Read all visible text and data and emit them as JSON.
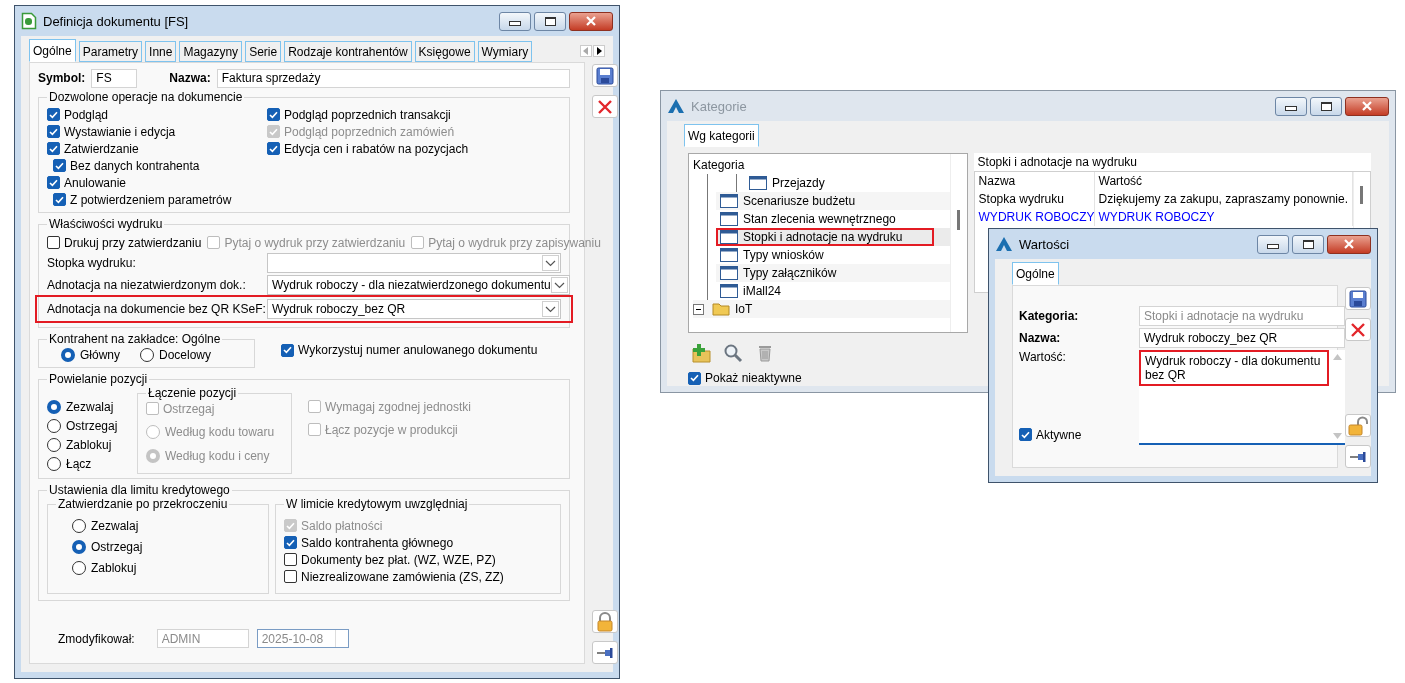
{
  "document_window": {
    "title": "Definicja dokumentu [FS]",
    "focused": true,
    "tabs": [
      {
        "label": "Ogólne",
        "selected": true
      },
      {
        "label": "Parametry",
        "selected": false
      },
      {
        "label": "Inne",
        "selected": false
      },
      {
        "label": "Magazyny",
        "selected": false
      },
      {
        "label": "Serie",
        "selected": false
      },
      {
        "label": "Rodzaje kontrahentów",
        "selected": false
      },
      {
        "label": "Księgowe",
        "selected": false
      },
      {
        "label": "Wymiary",
        "selected": false
      }
    ],
    "symbol": {
      "label": "Symbol:",
      "value": "FS"
    },
    "name": {
      "label": "Nazwa:",
      "value": "Faktura sprzedaży"
    },
    "operations": {
      "title": "Dozwolone operacje na dokumencie",
      "left": [
        {
          "label": "Podgląd",
          "checked": true,
          "disabled": false
        },
        {
          "label": "Wystawianie i edycja",
          "checked": true,
          "disabled": false
        },
        {
          "label": "Zatwierdzanie",
          "checked": true,
          "disabled": false,
          "children": [
            {
              "label": "Bez danych kontrahenta",
              "checked": true,
              "disabled": false
            }
          ]
        },
        {
          "label": "Anulowanie",
          "checked": true,
          "disabled": false,
          "children": [
            {
              "label": "Z potwierdzeniem parametrów",
              "checked": true,
              "disabled": false
            }
          ]
        }
      ],
      "right": [
        {
          "label": "Podgląd poprzednich transakcji",
          "checked": true,
          "disabled": false
        },
        {
          "label": "Podgląd poprzednich zamówień",
          "checked": true,
          "disabled": true
        },
        {
          "label": "Edycja cen i rabatów na pozycjach",
          "checked": true,
          "disabled": false
        }
      ]
    },
    "print": {
      "title": "Właściwości wydruku",
      "options": [
        {
          "label": "Drukuj przy zatwierdzaniu",
          "checked": false,
          "disabled": false
        },
        {
          "label": "Pytaj o wydruk przy zatwierdzaniu",
          "checked": false,
          "disabled": true
        },
        {
          "label": "Pytaj o wydruk przy zapisywaniu",
          "checked": false,
          "disabled": true
        }
      ],
      "fields": [
        {
          "label": "Stopka wydruku:",
          "highlighted": false
        },
        {
          "label": "Adnotacja na niezatwierdzonym dok.:",
          "value": "Wydruk roboczy - dla niezatwierdzonego dokumentu",
          "highlighted": false
        },
        {
          "label": "Adnotacja na dokumencie bez QR KSeF:",
          "value": "Wydruk roboczy_bez QR",
          "highlighted": true
        }
      ]
    },
    "contractor": {
      "title": "Kontrahent na zakładce: Ogólne",
      "options": [
        {
          "label": "Główny",
          "selected": true
        },
        {
          "label": "Docelowy",
          "selected": false
        }
      ]
    },
    "reuse_number": {
      "label": "Wykorzystuj numer anulowanego dokumentu",
      "checked": true,
      "disabled": false
    },
    "duplication": {
      "title": "Powielanie pozycji",
      "options": [
        {
          "label": "Zezwalaj",
          "selected": true
        },
        {
          "label": "Ostrzegaj",
          "selected": false
        },
        {
          "label": "Zablokuj",
          "selected": false
        },
        {
          "label": "Łącz",
          "selected": false
        }
      ],
      "merging": {
        "title": "Łączenie pozycji",
        "warn": {
          "label": "Ostrzegaj",
          "checked": false,
          "disabled": true
        },
        "options": [
          {
            "label": "Według kodu towaru",
            "selected": false,
            "disabled": true
          },
          {
            "label": "Według kodu i ceny",
            "selected": true,
            "disabled": true
          }
        ]
      },
      "extra": [
        {
          "label": "Wymagaj zgodnej jednostki",
          "checked": false,
          "disabled": true
        },
        {
          "label": "Łącz pozycje w produkcji",
          "checked": false,
          "disabled": true
        }
      ]
    },
    "credit": {
      "title": "Ustawienia dla limitu kredytowego",
      "approval": {
        "title": "Zatwierdzanie po przekroczeniu",
        "options": [
          {
            "label": "Zezwalaj",
            "selected": false
          },
          {
            "label": "Ostrzegaj",
            "selected": true
          },
          {
            "label": "Zablokuj",
            "selected": false
          }
        ]
      },
      "include": {
        "title": "W limicie kredytowym uwzględniaj",
        "options": [
          {
            "label": "Saldo płatności",
            "checked": true,
            "disabled": true
          },
          {
            "label": "Saldo kontrahenta głównego",
            "checked": true,
            "disabled": false
          },
          {
            "label": "Dokumenty bez płat. (WZ, WZE, PZ)",
            "checked": false,
            "disabled": false
          },
          {
            "label": "Niezrealizowane zamówienia (ZS, ZZ)",
            "checked": false,
            "disabled": false
          }
        ]
      }
    },
    "modified": {
      "label": "Zmodyfikował:",
      "user": "ADMIN",
      "user_read_only": true,
      "date": "2025-10-08"
    }
  },
  "categories_window": {
    "title": "Kategorie",
    "focused": false,
    "tabs": [
      {
        "label": "Wg kategorii",
        "selected": true
      }
    ],
    "tree": {
      "header": "Kategoria",
      "items": [
        {
          "children": [
            {
              "children": [
                {
                  "label": "Przejazdy",
                  "kind": "form",
                  "selected": false
                }
              ]
            },
            {
              "label": "Scenariusze budżetu",
              "kind": "form",
              "selected": false
            },
            {
              "label": "Stan zlecenia wewnętrznego",
              "kind": "form",
              "selected": false
            },
            {
              "label": "Stopki i adnotacje na wydruku",
              "kind": "form",
              "selected": true
            },
            {
              "label": "Typy wniosków",
              "kind": "form",
              "selected": false
            },
            {
              "label": "Typy załączników",
              "kind": "form",
              "selected": false
            },
            {
              "label": "iMall24",
              "kind": "form",
              "selected": false
            }
          ]
        },
        {
          "label": "IoT",
          "kind": "folder",
          "expanded": true,
          "selected": false
        }
      ]
    },
    "detail": {
      "title": "Stopki i adnotacje na wydruku",
      "columns": [
        "Nazwa",
        "Wartość"
      ],
      "rows": [
        {
          "cells": [
            "Stopka wydruku",
            "Dziękujemy za zakupu, zapraszamy ponownie."
          ],
          "color": "#000000"
        },
        {
          "cells": [
            "WYDRUK ROBOCZY",
            "WYDRUK ROBOCZY"
          ],
          "color": "#0000ff"
        }
      ]
    },
    "show_inactive": {
      "label": "Pokaż nieaktywne",
      "checked": true
    }
  },
  "values_window": {
    "title": "Wartości",
    "focused": true,
    "tabs": [
      {
        "label": "Ogólne",
        "selected": true
      }
    ],
    "category": {
      "label": "Kategoria:",
      "value": "Stopki i adnotacje na wydruku",
      "read_only": true
    },
    "name": {
      "label": "Nazwa:",
      "value": "Wydruk roboczy_bez QR"
    },
    "value": {
      "label": "Wartość:",
      "value": "Wydruk roboczy - dla dokumentu bez QR",
      "highlighted": true
    },
    "active": {
      "label": "Aktywne",
      "checked": true
    }
  }
}
